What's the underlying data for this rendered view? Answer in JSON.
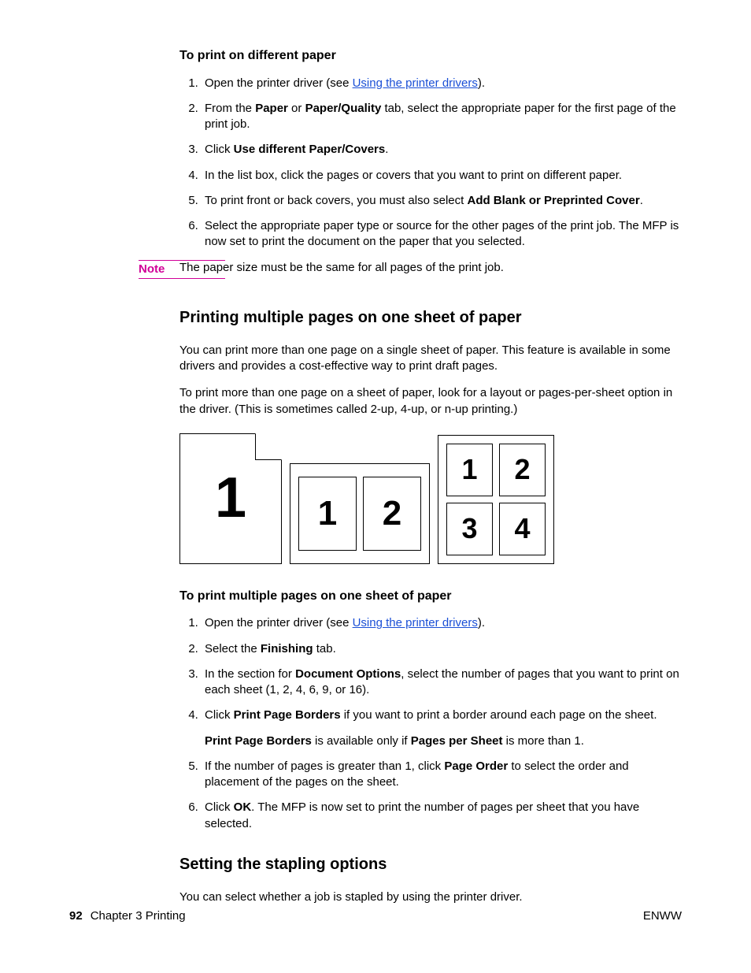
{
  "section1": {
    "heading": "To print on different paper",
    "steps": [
      {
        "pre": "Open the printer driver (see ",
        "link": "Using the printer drivers",
        "post": ")."
      },
      {
        "pre": "From the ",
        "b1": "Paper",
        "mid1": " or ",
        "b2": "Paper/Quality",
        "post": " tab, select the appropriate paper for the first page of the print job."
      },
      {
        "pre": "Click ",
        "b1": "Use different Paper/Covers",
        "post": "."
      },
      {
        "text": "In the list box, click the pages or covers that you want to print on different paper."
      },
      {
        "pre": "To print front or back covers, you must also select ",
        "b1": "Add Blank or Preprinted Cover",
        "post": "."
      },
      {
        "text": "Select the appropriate paper type or source for the other pages of the print job. The MFP is now set to print the document on the paper that you selected."
      }
    ]
  },
  "note": {
    "label": "Note",
    "text": "The paper size must be the same for all pages of the print job."
  },
  "section2": {
    "heading": "Printing multiple pages on one sheet of paper",
    "p1": "You can print more than one page on a single sheet of paper. This feature is available in some drivers and provides a cost-effective way to print draft pages.",
    "p2": "To print more than one page on a sheet of paper, look for a layout or pages-per-sheet option in the driver. (This is sometimes called 2-up, 4-up, or n-up printing.)",
    "diagram": {
      "a": "1",
      "b1": "1",
      "b2": "2",
      "c1": "1",
      "c2": "2",
      "c3": "3",
      "c4": "4"
    },
    "sub": "To print multiple pages on one sheet of paper",
    "steps": [
      {
        "pre": "Open the printer driver (see ",
        "link": "Using the printer drivers",
        "post": ")."
      },
      {
        "pre": "Select the ",
        "b1": "Finishing",
        "post": " tab."
      },
      {
        "pre": "In the section for ",
        "b1": "Document Options",
        "post": ", select the number of pages that you want to print on each sheet (1, 2, 4, 6, 9, or 16)."
      },
      {
        "pre": "Click ",
        "b1": "Print Page Borders",
        "post": " if you want to print a border around each page on the sheet.",
        "extra_pre": "",
        "extra_b1": "Print Page Borders",
        "extra_mid": " is available only if ",
        "extra_b2": "Pages per Sheet",
        "extra_post": " is more than 1."
      },
      {
        "pre": "If the number of pages is greater than 1, click ",
        "b1": "Page Order",
        "post": " to select the order and placement of the pages on the sheet."
      },
      {
        "pre": "Click ",
        "b1": "OK",
        "post": ". The MFP is now set to print the number of pages per sheet that you have selected."
      }
    ]
  },
  "section3": {
    "heading": "Setting the stapling options",
    "p1": "You can select whether a job is stapled by using the printer driver."
  },
  "footer": {
    "page": "92",
    "chapter": "Chapter 3  Printing",
    "right": "ENWW"
  }
}
